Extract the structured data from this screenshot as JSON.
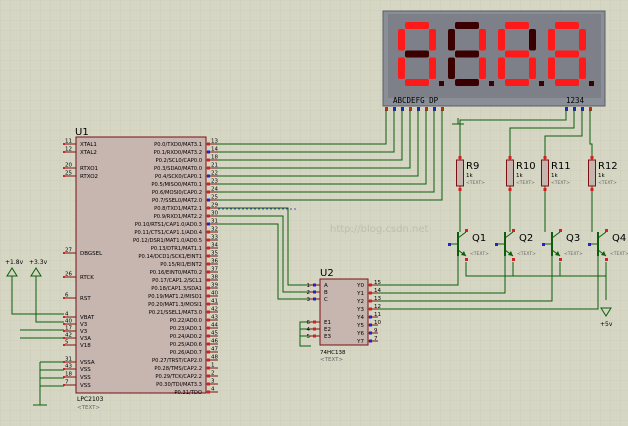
{
  "display": {
    "digits": [
      "0",
      "1",
      "6",
      "8"
    ],
    "seg_label": "ABCDEFG  DP",
    "com_label": "1234",
    "on_color": "#ff1a1a",
    "off_color": "#3a0000"
  },
  "u1": {
    "ref": "U1",
    "part": "LPC2103",
    "text": "<TEXT>",
    "left_pins": [
      {
        "num": "11",
        "name": "XTAL1"
      },
      {
        "num": "12",
        "name": "XTAL2"
      },
      {
        "num": "20",
        "name": "RTXO1"
      },
      {
        "num": "25",
        "name": "RTXO2"
      },
      {
        "num": "27",
        "name": "DBGSEL"
      },
      {
        "num": "26",
        "name": "RTCK"
      },
      {
        "num": "6",
        "name": "RST"
      },
      {
        "num": "4",
        "name": "VBAT"
      },
      {
        "num": "40",
        "name": "V3"
      },
      {
        "num": "17",
        "name": "V3"
      },
      {
        "num": "42",
        "name": "V3A"
      },
      {
        "num": "5",
        "name": "V18"
      },
      {
        "num": "31",
        "name": "VSSA"
      },
      {
        "num": "43",
        "name": "VSS"
      },
      {
        "num": "18",
        "name": "VSS"
      },
      {
        "num": "7",
        "name": "VSS"
      }
    ],
    "right_pins": [
      {
        "num": "13",
        "name": "P0.0/TXD0/MAT3.1"
      },
      {
        "num": "14",
        "name": "P0.1/RXD0/MAT3.2"
      },
      {
        "num": "18",
        "name": "P0.2/SCL0/CAP0.0"
      },
      {
        "num": "21",
        "name": "P0.3/SDA0/MAT0.0"
      },
      {
        "num": "22",
        "name": "P0.4/SCK0/CAP0.1"
      },
      {
        "num": "23",
        "name": "P0.5/MISO0/MAT0.1"
      },
      {
        "num": "24",
        "name": "P0.6/MOSI0/CAP0.2"
      },
      {
        "num": "25",
        "name": "P0.7/SSEL0/MAT2.0"
      },
      {
        "num": "29",
        "name": "P0.8/TXD1/MAT2.1"
      },
      {
        "num": "30",
        "name": "P0.9/RXD1/MAT2.2"
      },
      {
        "num": "31",
        "name": "P0.10/RTS1/CAP1.0/AD0.3"
      },
      {
        "num": "32",
        "name": "P0.11/CTS1/CAP1.1/AD0.4"
      },
      {
        "num": "33",
        "name": "P0.12/DSR1/MAT1.0/AD0.5"
      },
      {
        "num": "34",
        "name": "P0.13/DTR1/MAT1.1"
      },
      {
        "num": "35",
        "name": "P0.14/DCD1/SCK1/EINT1"
      },
      {
        "num": "36",
        "name": "P0.15/RI1/EINT2"
      },
      {
        "num": "37",
        "name": "P0.16/EINT0/MAT0.2"
      },
      {
        "num": "38",
        "name": "P0.17/CAP1.2/SCL1"
      },
      {
        "num": "39",
        "name": "P0.18/CAP1.3/SDA1"
      },
      {
        "num": "40",
        "name": "P0.19/MAT1.2/MISO1"
      },
      {
        "num": "41",
        "name": "P0.20/MAT1.3/MOSI1"
      },
      {
        "num": "42",
        "name": "P0.21/SSEL1/MAT3.0"
      },
      {
        "num": "43",
        "name": "P0.22/AD0.0"
      },
      {
        "num": "44",
        "name": "P0.23/AD0.1"
      },
      {
        "num": "45",
        "name": "P0.24/AD0.2"
      },
      {
        "num": "46",
        "name": "P0.25/AD0.6"
      },
      {
        "num": "47",
        "name": "P0.26/AD0.7"
      },
      {
        "num": "48",
        "name": "P0.27/TRST/CAP2.0"
      },
      {
        "num": "1",
        "name": "P0.28/TMS/CAP2.2"
      },
      {
        "num": "2",
        "name": "P0.29/TCK/CAP2.2"
      },
      {
        "num": "3",
        "name": "P0.30/TDI/MAT3.3"
      },
      {
        "num": "4",
        "name": "P0.31/TDO"
      }
    ]
  },
  "u2": {
    "ref": "U2",
    "part": "74HC138",
    "text": "<TEXT>",
    "left_pins": [
      {
        "num": "1",
        "name": "A"
      },
      {
        "num": "2",
        "name": "B"
      },
      {
        "num": "3",
        "name": "C"
      },
      {
        "num": "6",
        "name": "E1"
      },
      {
        "num": "4",
        "name": "E2"
      },
      {
        "num": "5",
        "name": "E3"
      }
    ],
    "right_pins": [
      {
        "num": "15",
        "name": "Y0"
      },
      {
        "num": "14",
        "name": "Y1"
      },
      {
        "num": "13",
        "name": "Y2"
      },
      {
        "num": "12",
        "name": "Y3"
      },
      {
        "num": "11",
        "name": "Y4"
      },
      {
        "num": "10",
        "name": "Y5"
      },
      {
        "num": "9",
        "name": "Y6"
      },
      {
        "num": "7",
        "name": "Y7"
      }
    ]
  },
  "resistors": [
    {
      "ref": "R9",
      "value": "1k",
      "text": "<TEXT>"
    },
    {
      "ref": "R10",
      "value": "1k",
      "text": "<TEXT>"
    },
    {
      "ref": "R11",
      "value": "1k",
      "text": "<TEXT>"
    },
    {
      "ref": "R12",
      "value": "1k",
      "text": "<TEXT>"
    }
  ],
  "transistors": [
    {
      "ref": "Q1",
      "text": "<TEXT>"
    },
    {
      "ref": "Q2",
      "text": "<TEXT>"
    },
    {
      "ref": "Q3",
      "text": "<TEXT>"
    },
    {
      "ref": "Q4",
      "text": "<TEXT>"
    }
  ],
  "power": {
    "v1": "+1.8v",
    "v2": "+3.3v",
    "v3": "+5v"
  },
  "colors": {
    "background": "#d6d6c4",
    "grid": "#c4c4b0",
    "wire": "#0b5e0b",
    "body_fill": "#c7b5b0",
    "body_stroke": "#7a1010",
    "pin_red": "#d42020",
    "pin_blue": "#2020d4",
    "display_frame": "#8a8e96",
    "text": "#000000",
    "faint_text": "#666666"
  }
}
